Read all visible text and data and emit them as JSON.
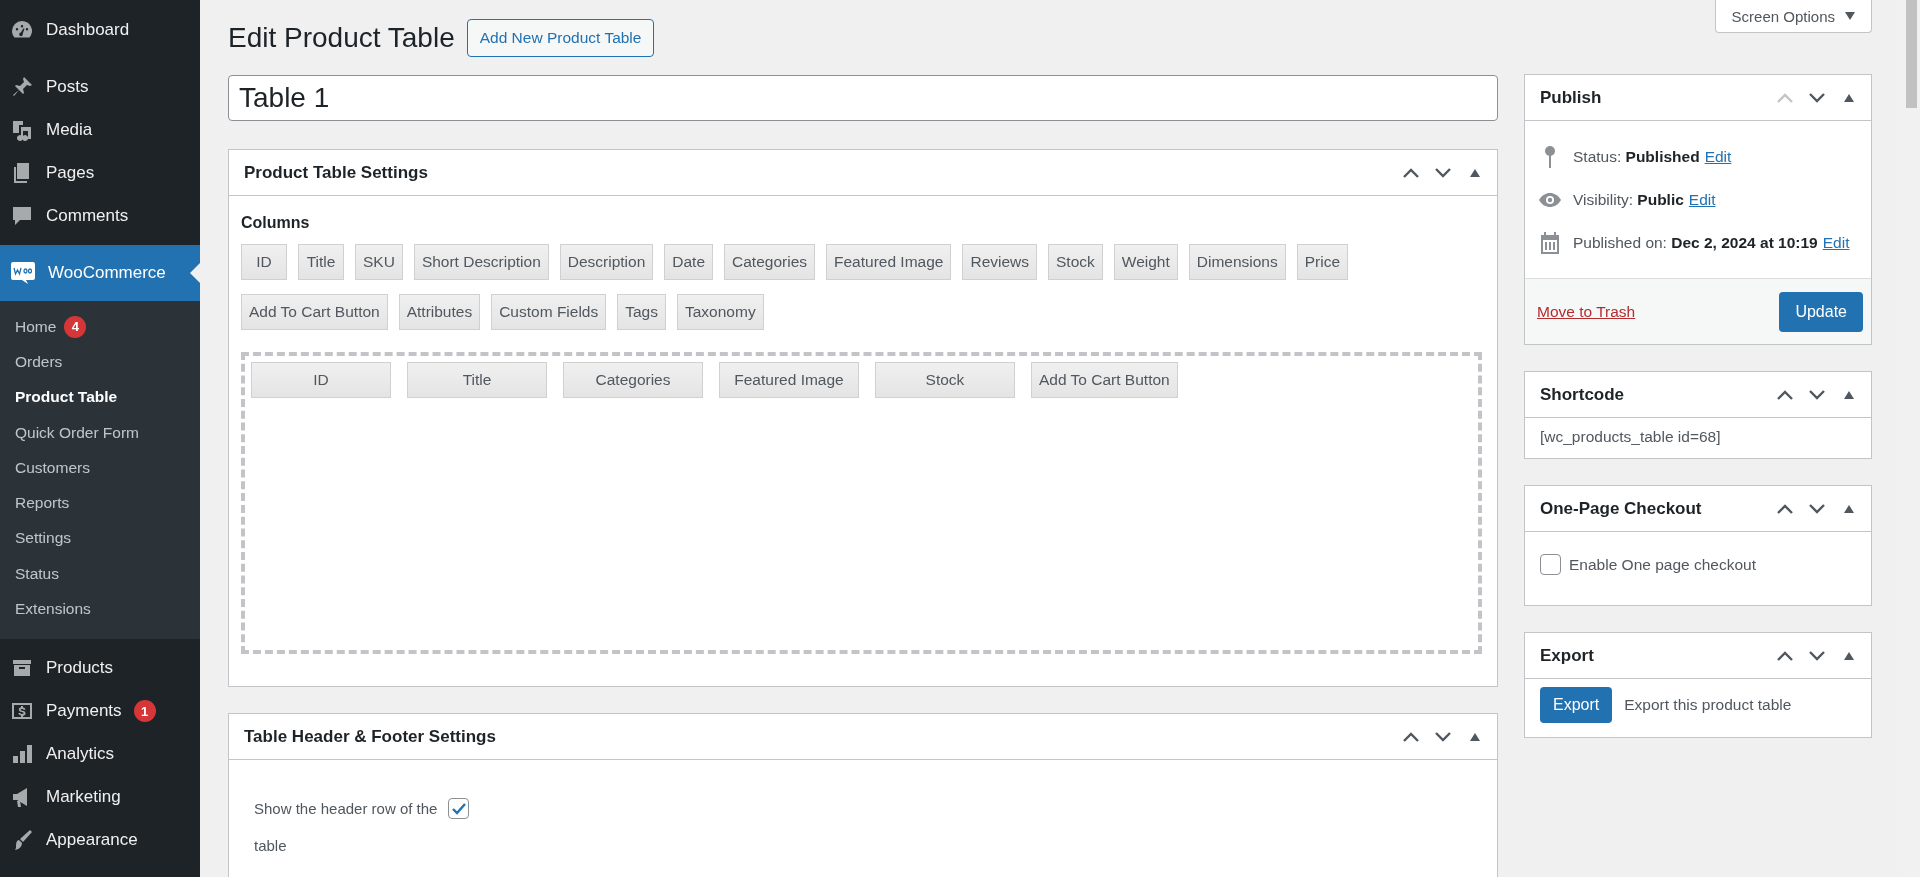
{
  "sidebar": {
    "items": [
      {
        "label": "Dashboard",
        "selected": false
      },
      {
        "label": "Posts",
        "selected": false
      },
      {
        "label": "Media",
        "selected": false
      },
      {
        "label": "Pages",
        "selected": false
      },
      {
        "label": "Comments",
        "selected": false
      },
      {
        "label": "WooCommerce",
        "selected": true,
        "children": [
          {
            "label": "Home",
            "badge": "4",
            "selected": false
          },
          {
            "label": "Orders",
            "selected": false
          },
          {
            "label": "Product Table",
            "selected": true
          },
          {
            "label": "Quick Order Form",
            "selected": false
          },
          {
            "label": "Customers",
            "selected": false
          },
          {
            "label": "Reports",
            "selected": false
          },
          {
            "label": "Settings",
            "selected": false
          },
          {
            "label": "Status",
            "selected": false
          },
          {
            "label": "Extensions",
            "selected": false
          }
        ]
      },
      {
        "label": "Products",
        "selected": false
      },
      {
        "label": "Payments",
        "badge": "1",
        "selected": false
      },
      {
        "label": "Analytics",
        "selected": false
      },
      {
        "label": "Marketing",
        "selected": false
      },
      {
        "label": "Appearance",
        "selected": false
      }
    ]
  },
  "screen_options": "Screen Options",
  "heading": "Edit Product Table",
  "add_new_button": "Add New Product Table",
  "title_field": {
    "value": "Table 1"
  },
  "settings_box": {
    "title": "Product Table Settings",
    "up_disabled": false,
    "columns_label": "Columns",
    "available_columns": [
      "ID",
      "Title",
      "SKU",
      "Short Description",
      "Description",
      "Date",
      "Categories",
      "Featured Image",
      "Reviews",
      "Stock",
      "Weight",
      "Dimensions",
      "Price",
      "Add To Cart Button",
      "Attributes",
      "Custom Fields",
      "Tags",
      "Taxonomy"
    ],
    "selected_columns": [
      "ID",
      "Title",
      "Categories",
      "Featured Image",
      "Stock",
      "Add To Cart Button"
    ]
  },
  "header_footer_box": {
    "title": "Table Header & Footer Settings",
    "up_disabled": false,
    "options": [
      {
        "label": "Show the header row of the table",
        "checked": true
      }
    ]
  },
  "publish_box": {
    "title": "Publish",
    "up_disabled": true,
    "rows": [
      {
        "kind": "status",
        "label": "Status:",
        "value": "Published",
        "link": "Edit"
      },
      {
        "kind": "visibility",
        "label": "Visibility:",
        "value": "Public",
        "link": "Edit"
      },
      {
        "kind": "date",
        "label": "Published on:",
        "value": "Dec 2, 2024 at 10:19",
        "link": "Edit"
      }
    ],
    "trash_link": "Move to Trash",
    "update_button": "Update"
  },
  "shortcode_box": {
    "title": "Shortcode",
    "up_disabled": false,
    "shortcode": "[wc_products_table id=68]"
  },
  "checkout_box": {
    "title": "One-Page Checkout",
    "up_disabled": false,
    "option": {
      "label": "Enable One page checkout",
      "checked": false
    }
  },
  "export_box": {
    "title": "Export",
    "up_disabled": false,
    "button": "Export",
    "description": "Export this product table"
  }
}
